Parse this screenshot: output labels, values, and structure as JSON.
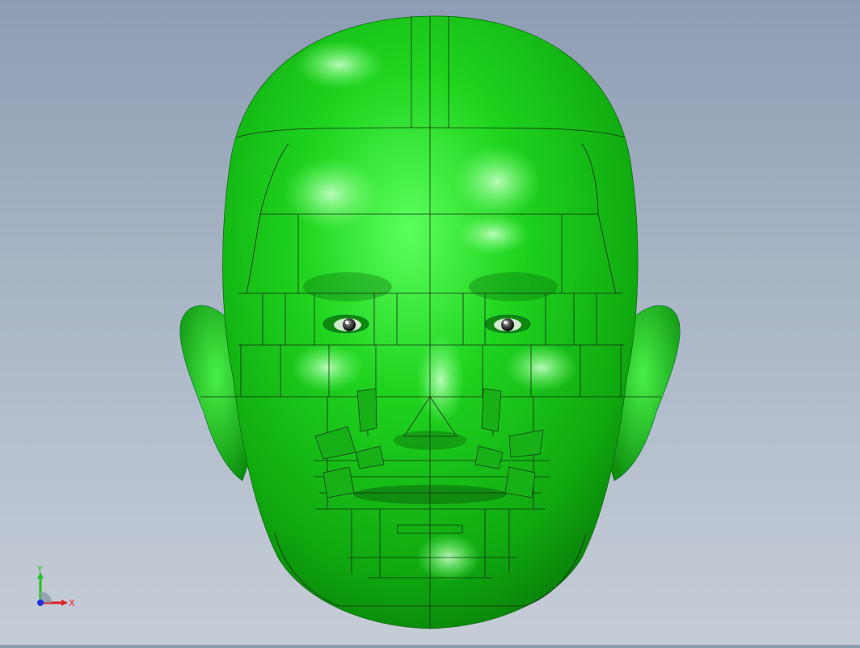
{
  "viewport": {
    "model": "head-3d-model",
    "model_color": "#19b519",
    "background_top": "#8d9db3",
    "background_bottom": "#c6cdd7"
  },
  "triad": {
    "x_label": "X",
    "y_label": "Y",
    "x_color": "#e02020",
    "y_color": "#20c020",
    "z_color": "#2030e0"
  }
}
